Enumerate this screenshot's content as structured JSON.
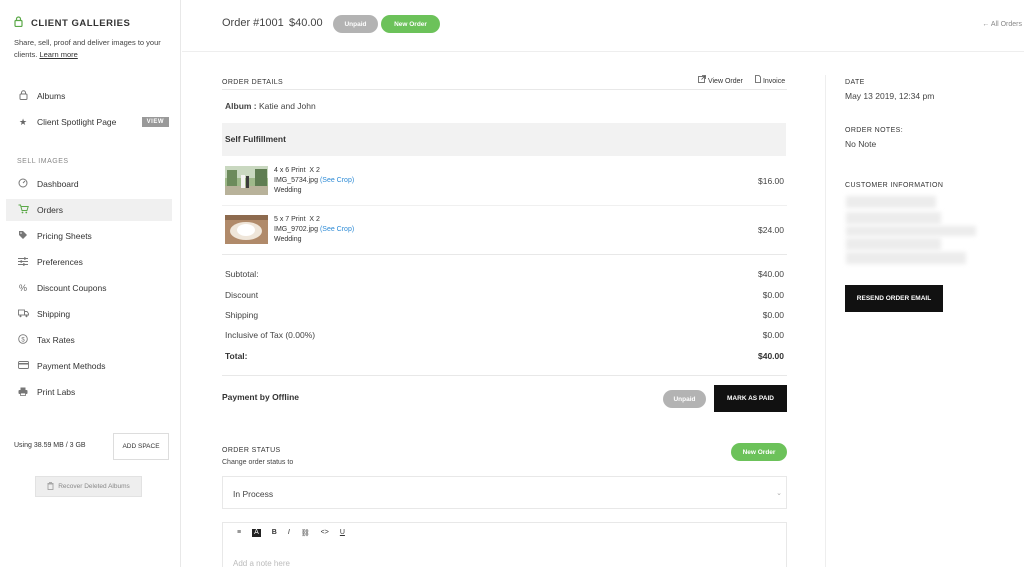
{
  "sidebar": {
    "brand_title": "CLIENT GALLERIES",
    "description": "Share, sell, proof and deliver images to your clients.",
    "learn_more": "Learn more",
    "items_top": [
      {
        "label": "Albums",
        "icon": "lock-icon"
      },
      {
        "label": "Client Spotlight Page",
        "icon": "star-icon",
        "badge": "VIEW"
      }
    ],
    "section_label": "SELL IMAGES",
    "items_sell": [
      {
        "label": "Dashboard",
        "icon": "gauge-icon"
      },
      {
        "label": "Orders",
        "icon": "cart-icon",
        "active": true
      },
      {
        "label": "Pricing Sheets",
        "icon": "tag-icon"
      },
      {
        "label": "Preferences",
        "icon": "sliders-icon"
      },
      {
        "label": "Discount Coupons",
        "icon": "percent-icon"
      },
      {
        "label": "Shipping",
        "icon": "truck-icon"
      },
      {
        "label": "Tax Rates",
        "icon": "dollar-icon"
      },
      {
        "label": "Payment Methods",
        "icon": "card-icon"
      },
      {
        "label": "Print Labs",
        "icon": "printer-icon"
      }
    ],
    "storage_text": "Using 38.59 MB / 3 GB",
    "add_space": "ADD SPACE",
    "recover": "Recover Deleted Albums"
  },
  "header": {
    "order_title": "Order #1001",
    "order_amount": "$40.00",
    "status_unpaid": "Unpaid",
    "status_new": "New Order",
    "all_orders": "All Orders"
  },
  "order_details": {
    "heading": "ORDER DETAILS",
    "view_order": "View Order",
    "invoice": "Invoice",
    "album_label": "Album :",
    "album_value": "Katie and John",
    "fulfillment": "Self Fulfillment",
    "items": [
      {
        "print": "4 x 6 Print",
        "qty": "X 2",
        "file": "IMG_5734.jpg",
        "crop": "(See Crop)",
        "collection": "Wedding",
        "price": "$16.00"
      },
      {
        "print": "5 x 7 Print",
        "qty": "X 2",
        "file": "IMG_9702.jpg",
        "crop": "(See Crop)",
        "collection": "Wedding",
        "price": "$24.00"
      }
    ],
    "totals": [
      {
        "label": "Subtotal:",
        "value": "$40.00"
      },
      {
        "label": "Discount",
        "value": "$0.00"
      },
      {
        "label": "Shipping",
        "value": "$0.00"
      },
      {
        "label": "Inclusive of Tax (0.00%)",
        "value": "$0.00"
      },
      {
        "label": "Total:",
        "value": "$40.00"
      }
    ],
    "payment_label": "Payment by Offline",
    "payment_status": "Unpaid",
    "mark_paid": "MARK AS PAID"
  },
  "order_status": {
    "heading": "ORDER STATUS",
    "sub": "Change order status to",
    "badge": "New Order",
    "selected": "In Process",
    "editor_tools": [
      "≡",
      "A",
      "B",
      "I",
      "⛓",
      "<>",
      "U"
    ],
    "note_placeholder": "Add a note here"
  },
  "side_info": {
    "date_label": "DATE",
    "date_value": "May 13 2019, 12:34 pm",
    "notes_label": "ORDER NOTES:",
    "notes_value": "No Note",
    "customer_label": "CUSTOMER INFORMATION",
    "resend": "RESEND ORDER EMAIL"
  },
  "colors": {
    "accent_green": "#6cc25a",
    "link_blue": "#2e8bd6",
    "muted_gray": "#b3b3b3"
  }
}
